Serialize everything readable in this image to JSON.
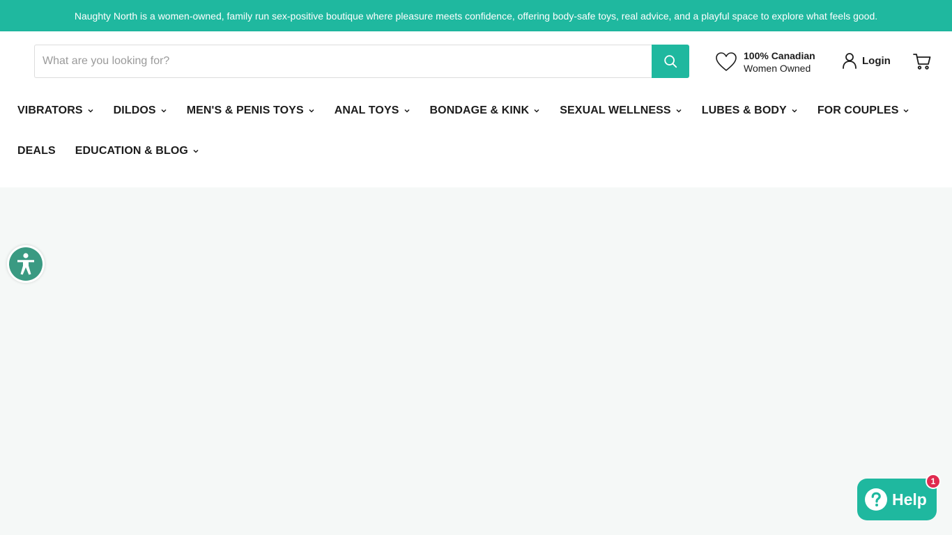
{
  "announcement": "Naughty North is a women-owned, family run sex-positive boutique where pleasure meets confidence, offering body-safe toys, real advice, and a playful space to explore what feels good.",
  "search": {
    "placeholder": "What are you looking for?",
    "value": "",
    "button_icon": "search-icon"
  },
  "promo": {
    "icon": "heart-icon",
    "title": "100% Canadian",
    "subtitle": "Women Owned"
  },
  "account": {
    "login_label": "Login",
    "icon": "user-icon"
  },
  "cart": {
    "icon": "cart-icon"
  },
  "nav": {
    "items": [
      {
        "label": "VIBRATORS",
        "has_dropdown": true
      },
      {
        "label": "DILDOS",
        "has_dropdown": true
      },
      {
        "label": "MEN'S & PENIS TOYS",
        "has_dropdown": true
      },
      {
        "label": "ANAL TOYS",
        "has_dropdown": true
      },
      {
        "label": "BONDAGE & KINK",
        "has_dropdown": true
      },
      {
        "label": "SEXUAL WELLNESS",
        "has_dropdown": true
      },
      {
        "label": "LUBES & BODY",
        "has_dropdown": true
      },
      {
        "label": "FOR COUPLES",
        "has_dropdown": true
      },
      {
        "label": "DEALS",
        "has_dropdown": false
      },
      {
        "label": "EDUCATION & BLOG",
        "has_dropdown": true
      }
    ]
  },
  "accessibility": {
    "icon": "accessibility-icon"
  },
  "help": {
    "label": "Help",
    "icon": "question-icon",
    "badge": "1"
  },
  "colors": {
    "brand": "#1fb89f",
    "accessibility": "#3a9a82",
    "badge": "#e02a4f",
    "page_bg": "#f5f8f7"
  }
}
